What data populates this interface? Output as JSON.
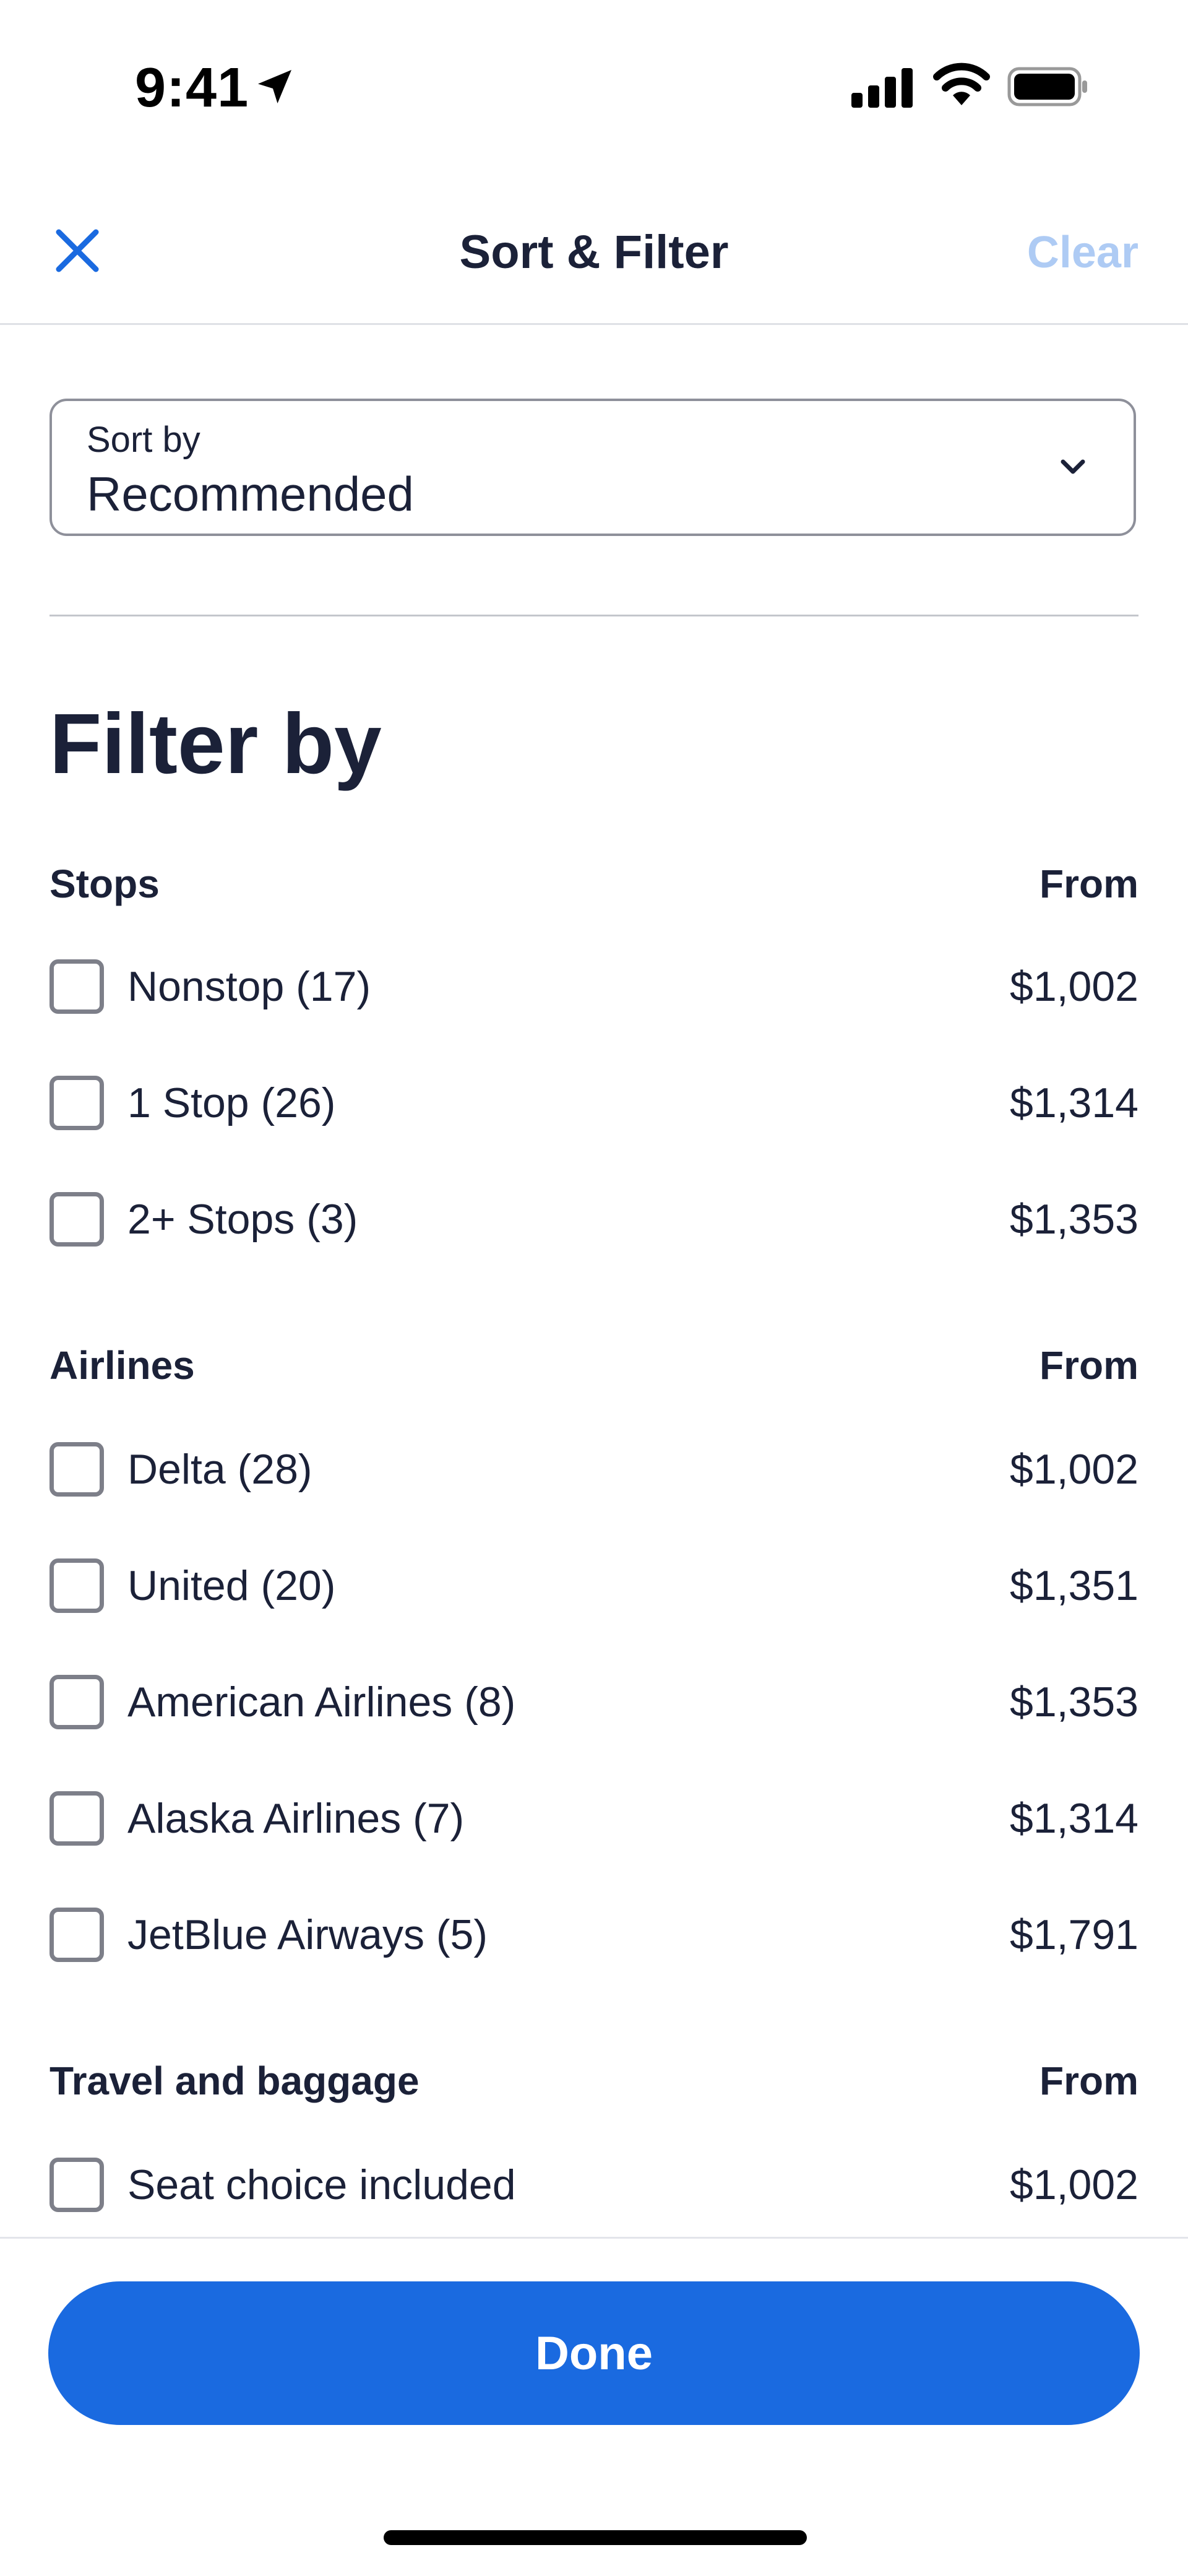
{
  "status_bar": {
    "time": "9:41"
  },
  "header": {
    "title": "Sort & Filter",
    "clear_label": "Clear",
    "accent_color": "#1a6ae0",
    "clear_color": "#aecbf4"
  },
  "sort": {
    "caption": "Sort by",
    "value": "Recommended"
  },
  "filter": {
    "heading": "Filter by",
    "groups": [
      {
        "title": "Stops",
        "from_label": "From",
        "options": [
          {
            "label": "Nonstop (17)",
            "price": "$1,002",
            "checked": false
          },
          {
            "label": "1 Stop (26)",
            "price": "$1,314",
            "checked": false
          },
          {
            "label": "2+ Stops (3)",
            "price": "$1,353",
            "checked": false
          }
        ]
      },
      {
        "title": "Airlines",
        "from_label": "From",
        "options": [
          {
            "label": "Delta (28)",
            "price": "$1,002",
            "checked": false
          },
          {
            "label": "United (20)",
            "price": "$1,351",
            "checked": false
          },
          {
            "label": "American Airlines (8)",
            "price": "$1,353",
            "checked": false
          },
          {
            "label": "Alaska Airlines (7)",
            "price": "$1,314",
            "checked": false
          },
          {
            "label": "JetBlue Airways (5)",
            "price": "$1,791",
            "checked": false
          }
        ]
      },
      {
        "title": "Travel and baggage",
        "from_label": "From",
        "options": [
          {
            "label": "Seat choice included",
            "price": "$1,002",
            "checked": false
          }
        ]
      }
    ]
  },
  "footer": {
    "done_label": "Done"
  }
}
